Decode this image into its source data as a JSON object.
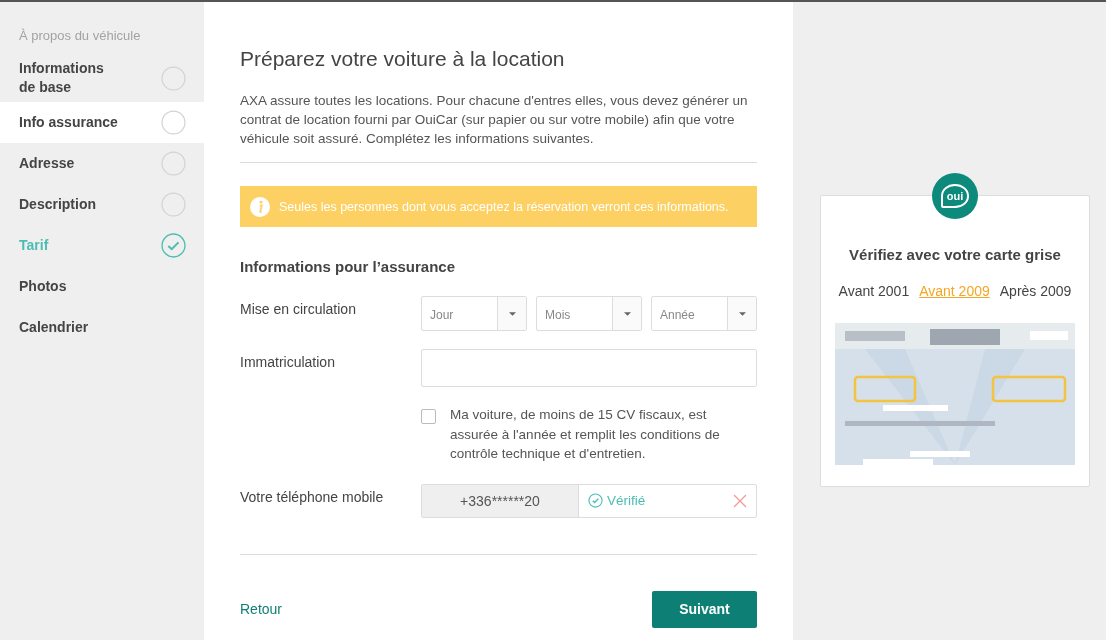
{
  "sidebar": {
    "section_title": "À propos du véhicule",
    "items": [
      {
        "label": "Informations de base",
        "kind": "step",
        "selected": false,
        "done": false
      },
      {
        "label": "Info assurance",
        "kind": "step",
        "selected": true,
        "done": false
      },
      {
        "label": "Adresse",
        "kind": "step",
        "selected": false,
        "done": false
      },
      {
        "label": "Description",
        "kind": "step",
        "selected": false,
        "done": false
      },
      {
        "label": "Tarif",
        "kind": "step",
        "selected": false,
        "done": true
      },
      {
        "label": "Photos",
        "kind": "plain",
        "selected": false
      },
      {
        "label": "Calendrier",
        "kind": "plain",
        "selected": false
      }
    ]
  },
  "main": {
    "title": "Préparez votre voiture à la location",
    "intro": "AXA assure toutes les locations. Pour chacune d'entres elles, vous devez générer un contrat de location fourni par OuiCar (sur papier ou sur votre mobile) afin que votre véhicule soit assuré. Complétez les informations suivantes.",
    "notice": "Seules les personnes dont vous acceptez la réservation verront ces informations.",
    "section_title": "Informations pour l’assurance",
    "fields": [
      {
        "kind": "date",
        "label": "Mise en circulation",
        "selects": [
          {
            "placeholder": "Jour"
          },
          {
            "placeholder": "Mois"
          },
          {
            "placeholder": "Année"
          }
        ]
      },
      {
        "kind": "text",
        "label": "Immatriculation"
      },
      {
        "kind": "checkbox",
        "checked": false,
        "text": "Ma voiture, de moins de 15 CV fiscaux, est assurée à l'année et remplit les conditions de contrôle technique et d'entretien."
      },
      {
        "kind": "phone",
        "label": "Votre téléphone mobile",
        "value": "+336******20",
        "status": "Vérifié",
        "verified": true
      }
    ],
    "back_link": "Retour",
    "next_button": "Suivant"
  },
  "aside": {
    "logo_text": "oui",
    "title": "Vérifiez avec votre carte grise",
    "periods": [
      {
        "label": "Avant 2001",
        "selected": false
      },
      {
        "label": "Avant 2009",
        "selected": true
      },
      {
        "label": "Après 2009",
        "selected": false
      }
    ]
  }
}
